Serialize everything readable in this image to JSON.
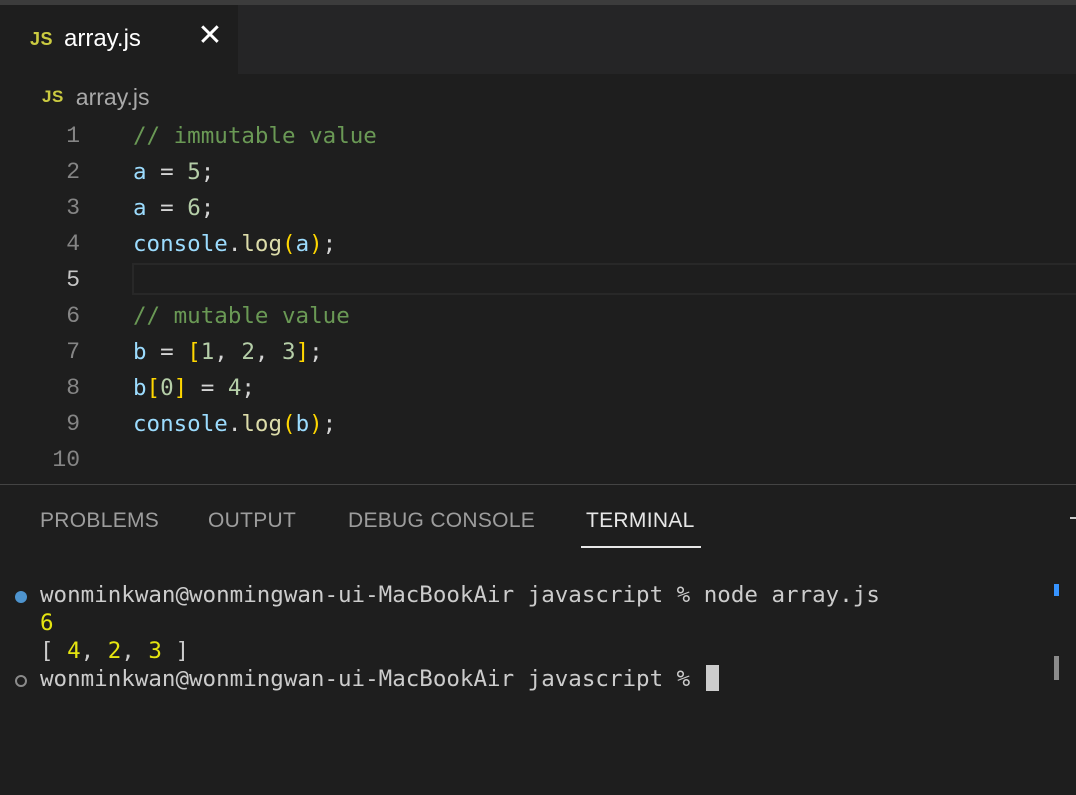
{
  "tab": {
    "badge": "JS",
    "filename": "array.js",
    "close": "✕"
  },
  "breadcrumb": {
    "badge": "JS",
    "filename": "array.js"
  },
  "editor": {
    "active_line": 5,
    "line_numbers": [
      "1",
      "2",
      "3",
      "4",
      "5",
      "6",
      "7",
      "8",
      "9",
      "10"
    ]
  },
  "panel": {
    "tabs": [
      "PROBLEMS",
      "OUTPUT",
      "DEBUG CONSOLE",
      "TERMINAL"
    ],
    "active_tab": "TERMINAL"
  },
  "terminal": {
    "prompt1": "wonminkwan@wonmingwan-ui-MacBookAir javascript % node array.js",
    "output1": "6",
    "output2_open": "[ ",
    "output2_v1": "4",
    "output2_sep1": ", ",
    "output2_v2": "2",
    "output2_sep2": ", ",
    "output2_v3": "3",
    "output2_close": " ]",
    "prompt2": "wonminkwan@wonmingwan-ui-MacBookAir javascript % "
  },
  "colors": {
    "status_dot_success": "#4e94ce",
    "js_badge": "#cbcb41"
  }
}
